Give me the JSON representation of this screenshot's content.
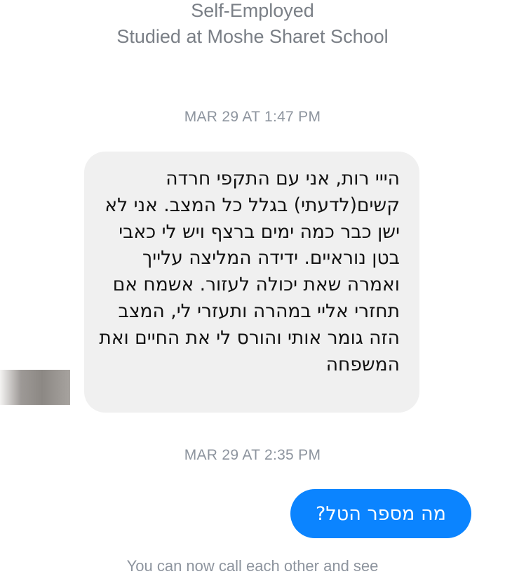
{
  "profile": {
    "work": "Self-Employed",
    "education": "Studied at Moshe Sharet School"
  },
  "conversation": {
    "timestamps": [
      "MAR 29 AT 1:47 PM",
      "MAR 29 AT 2:35 PM"
    ],
    "incoming_message": {
      "text": "הייי רות, אני עם התקפי חרדה קשים(לדעתי) בגלל כל המצב. אני לא ישן כבר כמה ימים ברצף ויש לי כאבי בטן נוראיים. ידידה המליצה עלייך ואמרה שאת יכולה לעזור. אשמח אם תחזרי אליי במהרה ותעזרי לי, המצב הזה גומר אותי והורס לי את החיים ואת המשפחה",
      "bubble_color": "#f0f0f0"
    },
    "outgoing_message": {
      "text": "מה מספר הטל?",
      "bubble_color": "#0b84ff"
    },
    "notice": "You can now call each other and see"
  }
}
